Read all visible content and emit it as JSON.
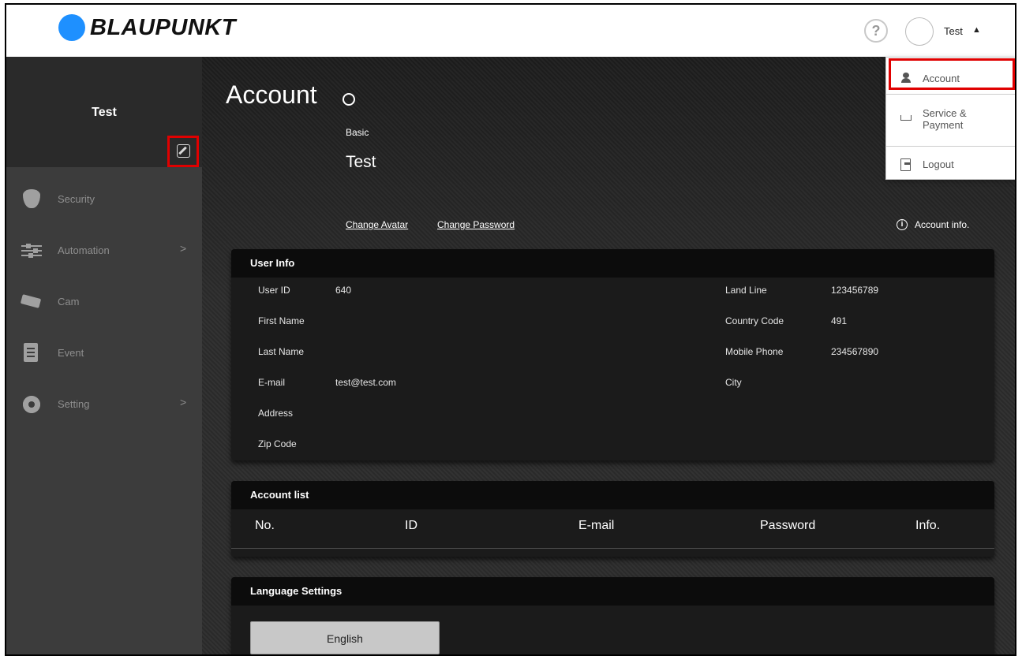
{
  "brand": {
    "name": "BLAUPUNKT"
  },
  "header": {
    "help": "?",
    "user": "Test",
    "caret": "▲"
  },
  "sidebar": {
    "profile_name": "Test",
    "items": [
      {
        "label": "Security",
        "icon": "shield-icon",
        "chevron": ""
      },
      {
        "label": "Automation",
        "icon": "sliders-icon",
        "chevron": ">"
      },
      {
        "label": "Cam",
        "icon": "camera-icon",
        "chevron": ""
      },
      {
        "label": "Event",
        "icon": "list-icon",
        "chevron": ""
      },
      {
        "label": "Setting",
        "icon": "gear-icon",
        "chevron": ">"
      }
    ]
  },
  "main": {
    "title": "Account",
    "basic": "Basic",
    "name": "Test",
    "change_avatar": "Change Avatar",
    "change_password": "Change Password",
    "account_info": "Account info."
  },
  "user_info": {
    "title": "User Info",
    "left": [
      {
        "label": "User ID",
        "value": "640"
      },
      {
        "label": "First Name",
        "value": ""
      },
      {
        "label": "Last Name",
        "value": ""
      },
      {
        "label": "E-mail",
        "value": "test@test.com"
      },
      {
        "label": "Address",
        "value": ""
      },
      {
        "label": "Zip Code",
        "value": ""
      }
    ],
    "right": [
      {
        "label": "Land Line",
        "value": "123456789"
      },
      {
        "label": "Country Code",
        "value": "491"
      },
      {
        "label": "Mobile Phone",
        "value": "234567890"
      },
      {
        "label": "City",
        "value": ""
      }
    ]
  },
  "account_list": {
    "title": "Account list",
    "columns": [
      "No.",
      "ID",
      "E-mail",
      "Password",
      "Info."
    ]
  },
  "language": {
    "title": "Language Settings",
    "button": "English"
  },
  "dropdown": {
    "account": "Account",
    "service_line1": "Service &",
    "service_line2": "Payment",
    "logout": "Logout"
  }
}
